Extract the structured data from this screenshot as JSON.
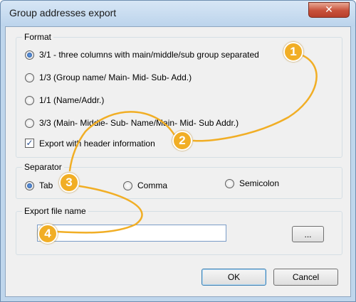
{
  "window": {
    "title": "Group addresses export",
    "close_glyph": "✕"
  },
  "format": {
    "legend": "Format",
    "options": [
      "3/1 - three columns with main/middle/sub group separated",
      "1/3 (Group name/ Main-  Mid- Sub- Add.)",
      "1/1 (Name/Addr.)",
      "3/3 (Main- Middle- Sub- Name/Main- Mid- Sub Addr.)"
    ],
    "selected": 0,
    "header_checkbox": {
      "label": "Export with header information",
      "checked": true,
      "glyph": "✓"
    }
  },
  "separator": {
    "legend": "Separator",
    "options": [
      "Tab",
      "Comma",
      "Semicolon"
    ],
    "selected": 0
  },
  "export_file": {
    "legend": "Export file name",
    "value": "",
    "browse_label": "..."
  },
  "buttons": {
    "ok": "OK",
    "cancel": "Cancel"
  },
  "callouts": [
    "1",
    "2",
    "3",
    "4"
  ],
  "colors": {
    "callout": "#f1ae25",
    "title_bar": "#bfd6ec",
    "close_button": "#c7503a"
  }
}
